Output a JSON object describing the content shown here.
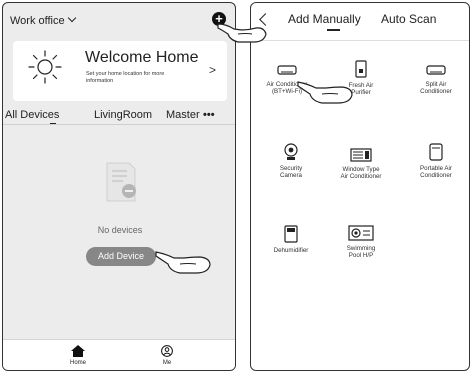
{
  "home": {
    "location": "Work office",
    "welcome_title": "Welcome Home",
    "welcome_subtitle": "Set your home location for more information",
    "tabs": [
      "All Devices",
      "LivingRoom",
      "Master"
    ],
    "empty_text": "No devices",
    "add_device_label": "Add Device",
    "nav": {
      "home": "Home",
      "me": "Me"
    }
  },
  "add": {
    "tab_manual": "Add Manually",
    "tab_auto": "Auto Scan",
    "devices": [
      {
        "label_1": "Air Conditioner",
        "label_2": "(BT+Wi-Fi)",
        "icon": "air-conditioner-icon"
      },
      {
        "label_1": "Fresh Air",
        "label_2": "Purifier",
        "icon": "fresh-air-purifier-icon"
      },
      {
        "label_1": "Split Air",
        "label_2": "Conditioner",
        "icon": "split-air-conditioner-icon"
      },
      {
        "label_1": "Security",
        "label_2": "Camera",
        "icon": "security-camera-icon"
      },
      {
        "label_1": "Window Type",
        "label_2": "Air Conditioner",
        "icon": "window-ac-icon"
      },
      {
        "label_1": "Portable Air",
        "label_2": "Conditioner",
        "icon": "portable-ac-icon"
      },
      {
        "label_1": "Dehumidifier",
        "label_2": "",
        "icon": "dehumidifier-icon"
      },
      {
        "label_1": "Swimming",
        "label_2": "Pool H/P",
        "icon": "pool-heat-pump-icon"
      }
    ]
  }
}
